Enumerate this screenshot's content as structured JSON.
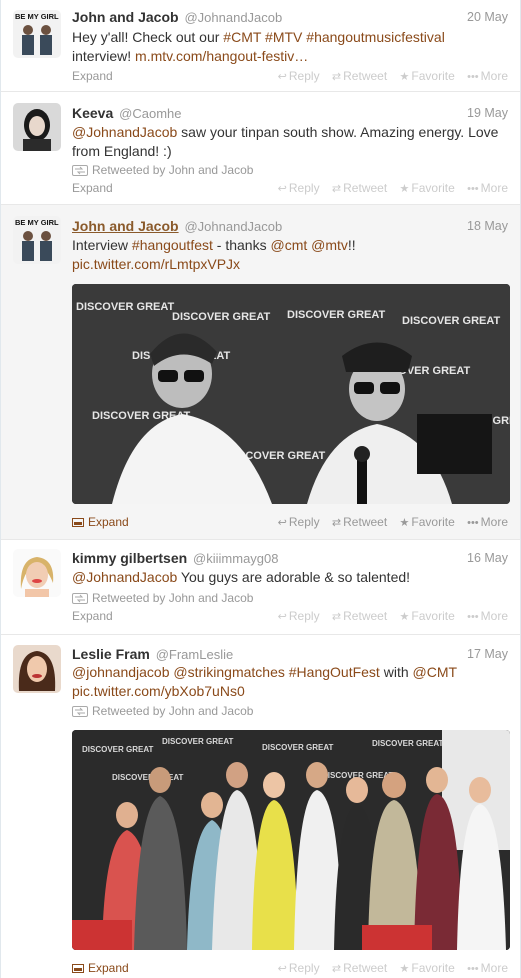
{
  "tweets": [
    {
      "name": "John and Jacob",
      "handle": "@JohnandJacob",
      "date": "20 May",
      "text_parts": [
        "Hey y'all! Check out our ",
        "#CMT",
        " ",
        "#MTV",
        " ",
        "#hangoutmusicfestival",
        " interview! ",
        "m.mtv.com/hangout-festiv…"
      ],
      "expand": "Expand"
    },
    {
      "name": "Keeva",
      "handle": "@Caomhe",
      "date": "19 May",
      "text_parts": [
        "@JohnandJacob",
        " saw your tinpan south show. Amazing energy. Love from England! :)"
      ],
      "retweeted_by": "Retweeted by John and Jacob",
      "expand": "Expand"
    },
    {
      "name": "John and Jacob",
      "handle": "@JohnandJacob",
      "date": "18 May",
      "text_parts": [
        "Interview ",
        "#hangoutfest",
        " - thanks ",
        "@cmt",
        " ",
        "@mtv",
        "!!"
      ],
      "link": "pic.twitter.com/rLmtpxVPJx",
      "expand": "Expand"
    },
    {
      "name": "kimmy gilbertsen",
      "handle": "@kiiimmayg08",
      "date": "16 May",
      "text_parts": [
        "@JohnandJacob",
        " You guys are adorable & so talented!"
      ],
      "retweeted_by": "Retweeted by John and Jacob",
      "expand": "Expand"
    },
    {
      "name": "Leslie Fram",
      "handle": "@FramLeslie",
      "date": "17 May",
      "text_parts": [
        "@johnandjacob",
        " ",
        "@strikingmatches",
        " ",
        "#HangOutFest",
        " with ",
        "@CMT"
      ],
      "link": "pic.twitter.com/ybXob7uNs0",
      "retweeted_by": "Retweeted by John and Jacob",
      "expand": "Expand"
    }
  ],
  "actions": {
    "reply": "Reply",
    "retweet": "Retweet",
    "favorite": "Favorite",
    "more": "More"
  },
  "avatar_text": "BE MY GIRL",
  "backdrop_text": "DISCOVER GREAT",
  "colors": {
    "link": "#8a4a1a",
    "meta": "#999999",
    "faint": "#cccccc"
  }
}
